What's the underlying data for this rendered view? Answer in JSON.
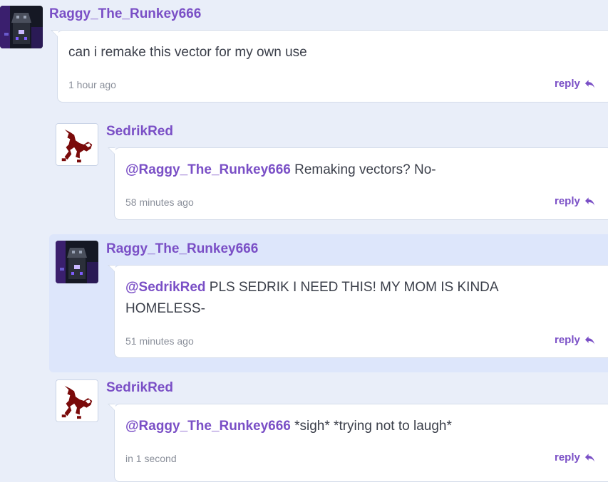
{
  "comments": [
    {
      "username": "Raggy_The_Runkey666",
      "avatar": "dark-character-avatar",
      "mention": "",
      "text": "can i remake this vector for my own use",
      "time": "1 hour ago",
      "reply_label": "reply"
    },
    {
      "username": "SedrikRed",
      "avatar": "red-creature-avatar",
      "mention": "@Raggy_The_Runkey666",
      "text": " Remaking vectors? No-",
      "time": "58 minutes ago",
      "reply_label": "reply"
    },
    {
      "username": "Raggy_The_Runkey666",
      "avatar": "dark-character-avatar",
      "mention": "@SedrikRed",
      "text": " PLS SEDRIK I NEED THIS! MY MOM IS KINDA HOMELESS-",
      "time": "51 minutes ago",
      "reply_label": "reply"
    },
    {
      "username": "SedrikRed",
      "avatar": "red-creature-avatar",
      "mention": "@Raggy_The_Runkey666",
      "text": " *sigh* *trying not to laugh*",
      "time": "in 1 second",
      "reply_label": "reply"
    }
  ],
  "colors": {
    "background": "#e9eef9",
    "highlight": "#dde6fb",
    "accent": "#7a4fc6",
    "text": "#3b3f4a",
    "muted": "#8a8f9a"
  },
  "icons": {
    "reply": "reply-arrow-icon"
  }
}
